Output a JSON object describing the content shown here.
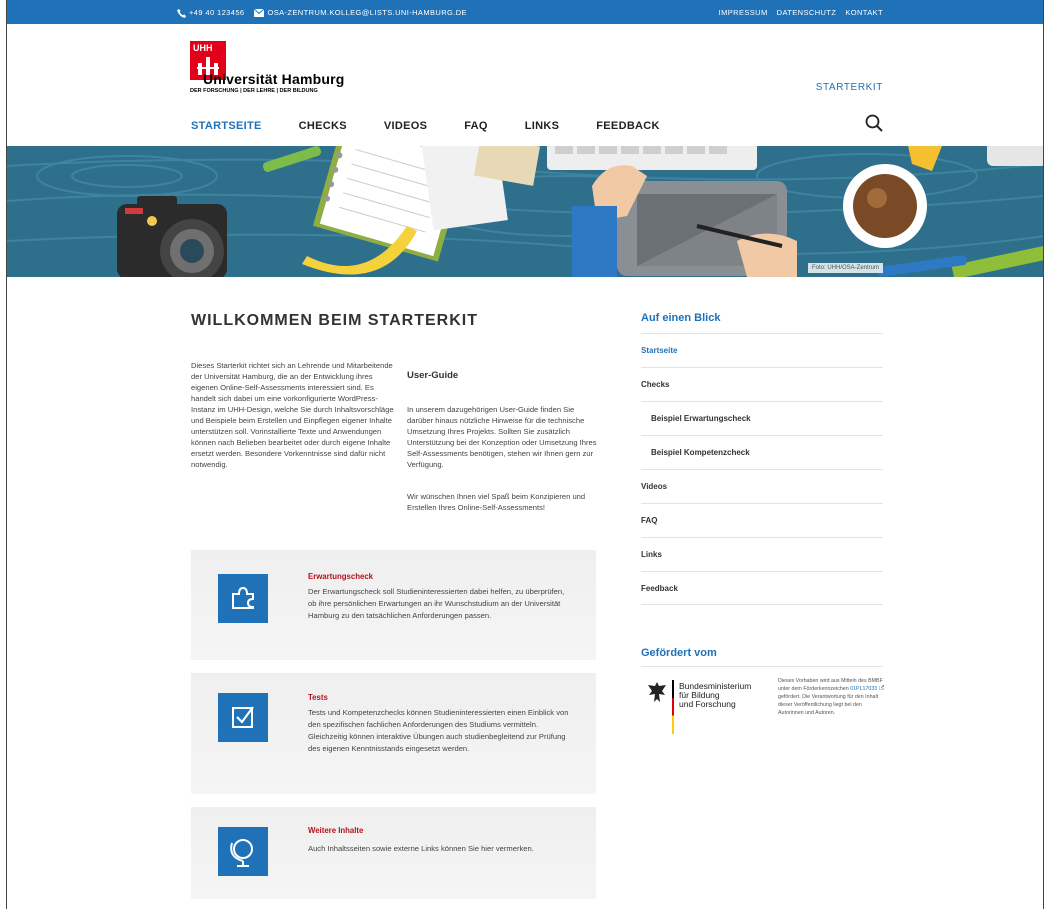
{
  "topbar": {
    "phone": "+49 40 123456",
    "email": "OSA-ZENTRUM.KOLLEG@LISTS.UNI-HAMBURG.DE",
    "links": [
      "IMPRESSUM",
      "DATENSCHUTZ",
      "KONTAKT"
    ]
  },
  "logo": {
    "mark_text": "UHH",
    "name": "Universität Hamburg",
    "tagline": "DER FORSCHUNG | DER LEHRE | DER BILDUNG"
  },
  "header": {
    "section_label": "STARTERKIT"
  },
  "nav": {
    "items": [
      "STARTSEITE",
      "CHECKS",
      "VIDEOS",
      "FAQ",
      "LINKS",
      "FEEDBACK"
    ],
    "active": "STARTSEITE"
  },
  "banner": {
    "credit": "Foto: UHH/OSA-Zentrum"
  },
  "main": {
    "title": "WILLKOMMEN BEIM STARTERKIT",
    "intro": "Dieses Starterkit richtet sich an Lehrende und Mitarbeitende der Universität Hamburg, die an der Entwicklung ihres eigenen Online-Self-Assessments interessiert sind. Es handelt sich dabei um eine vorkonfigurierte WordPress-Instanz im UHH-Design, welche Sie durch Inhaltsvorschläge und Beispiele beim Erstellen und Einpflegen eigener Inhalte unterstützen soll. Vorinstallierte Texte und Anwendungen können nach Belieben bearbeitet oder durch eigene Inhalte ersetzt werden. Besondere Vorkenntnisse sind dafür nicht notwendig.",
    "guide_title": "User-Guide",
    "guide_p1": "In unserem dazugehörigen User-Guide finden Sie darüber hinaus nützliche Hinweise für die technische Umsetzung Ihres Projekts. Sollten Sie zusätzlich Unterstützung bei der Konzeption oder Umsetzung Ihres Self-Assessments benötigen, stehen wir Ihnen gern zur Verfügung.",
    "guide_p2": "Wir wünschen Ihnen viel Spaß beim Konzipieren und Erstellen Ihres Online-Self-Assessments!"
  },
  "cards": [
    {
      "icon": "puzzle-icon",
      "title": "Erwartungscheck",
      "text": "Der Erwartungscheck soll Studieninteressierten dabei helfen, zu überprüfen, ob ihre persönlichen Erwartungen an ihr Wunschstudium an der Universität Hamburg zu den tatsächlichen Anforderungen passen."
    },
    {
      "icon": "checkbox-icon",
      "title": "Tests",
      "text": "Tests und Kompetenzchecks können Studieninteressierten einen Einblick von den spezifischen fachlichen Anforderungen des Studiums vermitteln. Gleichzeitig können interaktive Übungen auch studienbegleitend zur Prüfung des eigenen Kenntnisstands eingesetzt werden."
    },
    {
      "icon": "globe-icon",
      "title": "Weitere Inhalte",
      "text": "Auch Inhaltsseiten sowie externe Links können Sie hier vermerken."
    }
  ],
  "sidebar": {
    "title": "Auf einen Blick",
    "items": [
      {
        "label": "Startseite",
        "active": true,
        "sub": false
      },
      {
        "label": "Checks",
        "active": false,
        "sub": false
      },
      {
        "label": "Beispiel Erwartungscheck",
        "active": false,
        "sub": true
      },
      {
        "label": "Beispiel Kompetenzcheck",
        "active": false,
        "sub": true
      },
      {
        "label": "Videos",
        "active": false,
        "sub": false
      },
      {
        "label": "FAQ",
        "active": false,
        "sub": false
      },
      {
        "label": "Links",
        "active": false,
        "sub": false
      },
      {
        "label": "Feedback",
        "active": false,
        "sub": false
      }
    ],
    "funded_title": "Gefördert vom",
    "ministry": [
      "Bundesministerium",
      "für Bildung",
      "und Forschung"
    ],
    "funding_text_1": "Dieses Vorhaben wird aus Mitteln des BMBF unter dem Förderkennzeichen",
    "funding_code": "01PL17033",
    "funding_text_2": "gefördert. Die Verantwortung für den Inhalt dieser Veröffentlichung liegt bei den Autorinnen und Autoren."
  },
  "colors": {
    "brand_blue": "#1f71b8",
    "uhh_red": "#e2001a",
    "card_title_red": "#b5121b"
  }
}
